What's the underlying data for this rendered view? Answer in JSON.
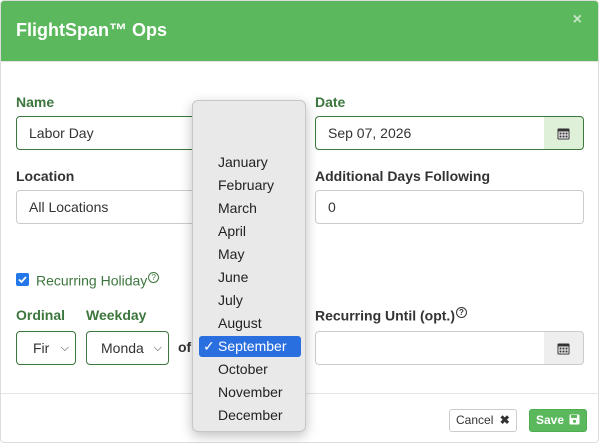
{
  "header": {
    "title": "FlightSpan™ Ops",
    "close": "×"
  },
  "form": {
    "name_label": "Name",
    "name_value": "Labor Day",
    "date_label": "Date",
    "date_value": "Sep 07, 2026",
    "location_label": "Location",
    "location_value": "All Locations",
    "additional_days_label": "Additional Days Following",
    "additional_days_value": "0",
    "recurring_label": "Recurring Holiday",
    "ordinal_label": "Ordinal",
    "ordinal_value": "Fir",
    "weekday_label": "Weekday",
    "weekday_value": "Monda",
    "of_label": "of",
    "recurring_until_label": "Recurring Until (opt.)",
    "recurring_until_value": ""
  },
  "month_dropdown": {
    "options": [
      "January",
      "February",
      "March",
      "April",
      "May",
      "June",
      "July",
      "August",
      "September",
      "October",
      "November",
      "December"
    ],
    "selected": "September"
  },
  "footer": {
    "cancel_label": "Cancel",
    "save_label": "Save"
  },
  "colors": {
    "header_bg": "#5cb85c",
    "success_text": "#3c763d",
    "select_highlight": "#2a6fe0"
  },
  "icons": {
    "calendar": "calendar-icon",
    "close": "close-icon",
    "cancel": "x-mark-icon",
    "save": "floppy-disk-icon",
    "help": "question-circle-icon",
    "checkbox": "checkmark-icon"
  }
}
